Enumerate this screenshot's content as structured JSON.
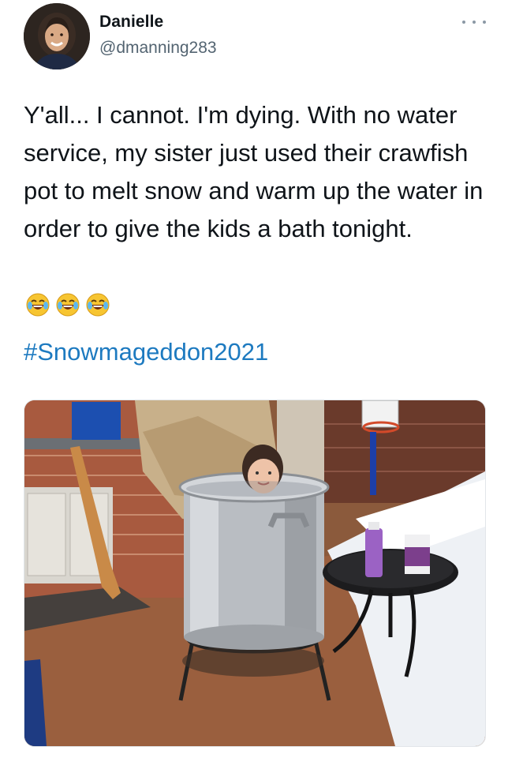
{
  "user": {
    "display_name": "Danielle",
    "handle": "@dmanning283"
  },
  "tweet": {
    "text": "Y'all... I cannot. I'm dying. With no water service, my sister just used their crawfish pot to melt snow and warm up the water in order to give the kids a bath tonight.",
    "emojis": [
      "face-with-tears-of-joy",
      "face-with-tears-of-joy",
      "face-with-tears-of-joy"
    ],
    "hashtag": "#Snowmageddon2021"
  },
  "icons": {
    "more": "more-options-icon"
  },
  "colors": {
    "text": "#0f1419",
    "secondary": "#536471",
    "link": "#1d7ac0"
  }
}
